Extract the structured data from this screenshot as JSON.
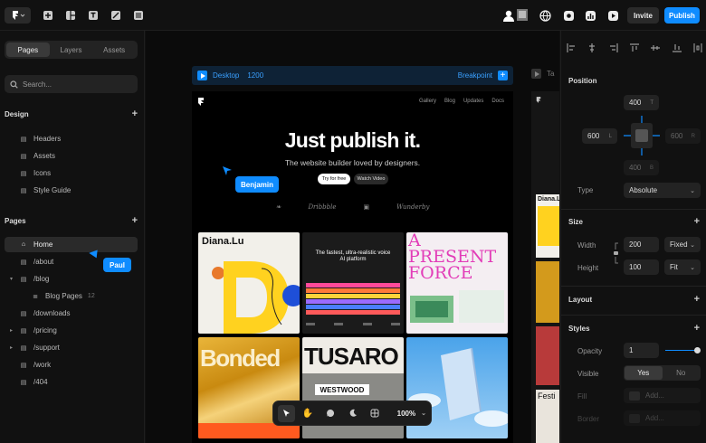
{
  "topbar": {
    "invite_label": "Invite",
    "publish_label": "Publish",
    "accent": "#0f8cff"
  },
  "left_panel": {
    "tabs": [
      "Pages",
      "Layers",
      "Assets"
    ],
    "active_tab": "Pages",
    "search_placeholder": "Search...",
    "design_section": {
      "title": "Design",
      "items": [
        "Headers",
        "Assets",
        "Icons",
        "Style Guide"
      ]
    },
    "pages_section": {
      "title": "Pages",
      "items": [
        {
          "label": "Home",
          "selected": true
        },
        {
          "label": "/about"
        },
        {
          "label": "/blog"
        },
        {
          "label": "Blog Pages",
          "count": "12"
        },
        {
          "label": "/downloads"
        },
        {
          "label": "/pricing"
        },
        {
          "label": "/support"
        },
        {
          "label": "/work"
        },
        {
          "label": "/404"
        }
      ]
    }
  },
  "canvas": {
    "frame_label": "Desktop",
    "frame_width": "1200",
    "breakpoint_label": "Breakpoint",
    "side_frame_label": "Ta",
    "site": {
      "nav": [
        "Gallery",
        "Blog",
        "Updates",
        "Docs"
      ],
      "headline": "Just publish it.",
      "subheadline": "The website builder loved by designers.",
      "cta_primary": "Try for free",
      "cta_secondary": "Watch Video",
      "logos": [
        "Dribbble",
        "Wunderby"
      ],
      "cards": {
        "c1_title": "Diana.Lu",
        "c2_title": "The fastest, ultra-realistic voice AI platform",
        "c3_title": "A PRESENT FORCE",
        "c4_title": "Bonded",
        "c5_title": "TUSARO",
        "c5_sub": "WESTWOOD",
        "side_title": "Diana.Lu",
        "side_fest": "Festi"
      }
    },
    "cursors": [
      {
        "name": "Benjamin"
      },
      {
        "name": "Paul"
      }
    ],
    "zoom": "100%"
  },
  "right_panel": {
    "position": {
      "title": "Position",
      "top": "400",
      "top_unit": "T",
      "left": "600",
      "left_unit": "L",
      "right": "600",
      "right_unit": "R",
      "bottom": "400",
      "bottom_unit": "B",
      "type_label": "Type",
      "type_value": "Absolute"
    },
    "size": {
      "title": "Size",
      "width_label": "Width",
      "width_value": "200",
      "width_mode": "Fixed",
      "height_label": "Height",
      "height_value": "100",
      "height_mode": "Fit"
    },
    "layout": {
      "title": "Layout"
    },
    "styles": {
      "title": "Styles",
      "opacity_label": "Opacity",
      "opacity_value": "1",
      "visible_label": "Visible",
      "visible_yes": "Yes",
      "visible_no": "No",
      "fill_label": "Fill",
      "fill_placeholder": "Add...",
      "border_label": "Border",
      "border_placeholder": "Add..."
    }
  }
}
